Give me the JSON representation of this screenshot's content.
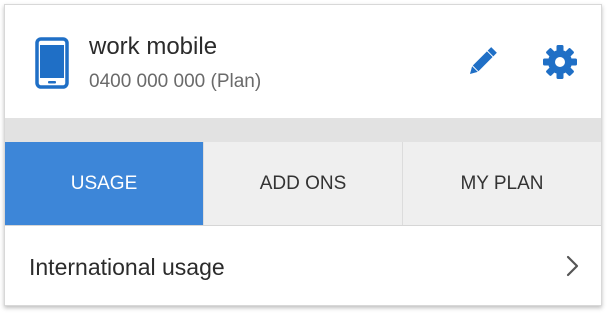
{
  "service": {
    "name": "work mobile",
    "number": "0400 000 000 (Plan)"
  },
  "icons": {
    "phone": "phone-icon",
    "edit": "pencil-icon",
    "settings": "gear-icon",
    "chevron": "chevron-right-icon"
  },
  "tabs": [
    {
      "label": "USAGE",
      "active": true
    },
    {
      "label": "ADD ONS",
      "active": false
    },
    {
      "label": "MY PLAN",
      "active": false
    }
  ],
  "list": {
    "items": [
      {
        "label": "International usage"
      }
    ]
  },
  "colors": {
    "accent": "#3d86d8",
    "icon_blue": "#1f6fc6",
    "band": "#e2e2e2",
    "tab_bg": "#efefef"
  }
}
